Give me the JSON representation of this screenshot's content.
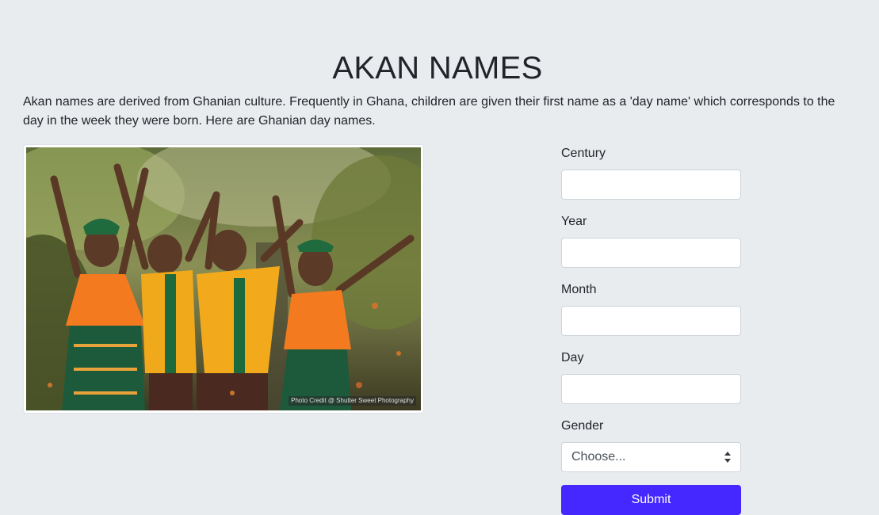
{
  "page": {
    "title": "AKAN NAMES",
    "intro": "Akan names are derived from Ghanian culture. Frequently in Ghana, children are given their first name as a 'day name' which corresponds to the day in the week they were born. Here are Ghanian day names."
  },
  "image": {
    "credit": "Photo Credit @ Shutter Sweet Photography"
  },
  "form": {
    "century_label": "Century",
    "century_value": "",
    "year_label": "Year",
    "year_value": "",
    "month_label": "Month",
    "month_value": "",
    "day_label": "Day",
    "day_value": "",
    "gender_label": "Gender",
    "gender_selected": "Choose...",
    "submit_label": "Submit"
  },
  "colors": {
    "background": "#e9ecef",
    "accent": "#4527ff"
  },
  "icons": {
    "select_arrow": "up-down-chevron-icon"
  }
}
